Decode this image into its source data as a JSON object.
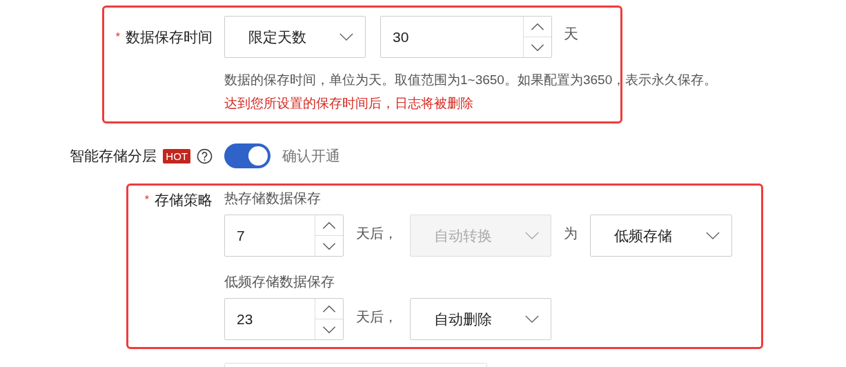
{
  "retention": {
    "required_mark": "*",
    "label": "数据保存时间",
    "mode_select": {
      "value": "限定天数",
      "disabled": false
    },
    "days": {
      "value": "30"
    },
    "unit": "天",
    "help": "数据的保存时间，单位为天。取值范围为1~3650。如果配置为3650，表示永久保存。",
    "warning": "达到您所设置的保存时间后，日志将被删除"
  },
  "tiering": {
    "label": "智能存储分层",
    "badge": "HOT",
    "switch": {
      "on": true,
      "label": "确认开通"
    }
  },
  "policy": {
    "required_mark": "*",
    "label": "存储策略",
    "stages": [
      {
        "title": "热存储数据保存",
        "days": "7",
        "unit": "天后，",
        "action": {
          "value": "自动转换",
          "disabled": true
        },
        "connector": "为",
        "target": {
          "value": "低频存储",
          "disabled": false
        }
      },
      {
        "title": "低频存储数据保存",
        "days": "23",
        "unit": "天后，",
        "action": {
          "value": "自动删除",
          "disabled": false
        }
      }
    ]
  }
}
